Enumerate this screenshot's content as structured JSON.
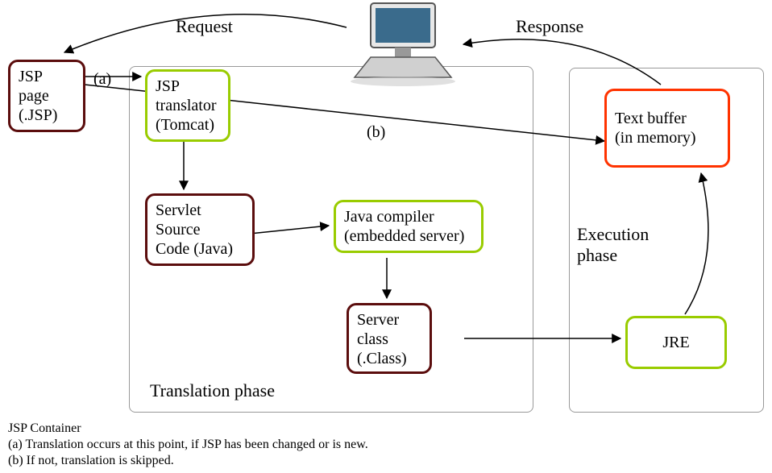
{
  "labels": {
    "request": "Request",
    "response": "Response",
    "a": "(a)",
    "b": "(b)",
    "translation_phase": "Translation phase",
    "execution_phase": "Execution\nphase"
  },
  "boxes": {
    "jsp_page": "JSP\npage\n(.JSP)",
    "jsp_translator": "JSP\ntranslator\n(Tomcat)",
    "servlet_source": "Servlet\nSource\nCode (Java)",
    "java_compiler": "Java compiler\n(embedded server)",
    "server_class": "Server\nclass\n(.Class)",
    "text_buffer": "Text buffer\n(in memory)",
    "jre": "JRE"
  },
  "footer": {
    "container": "JSP Container",
    "note_a": "(a) Translation occurs at this point, if JSP has been changed or is new.",
    "note_b": "(b) If not, translation is skipped."
  },
  "colors": {
    "darkred": "#5b0d0d",
    "red": "#ff3300",
    "green": "#99cc00"
  }
}
